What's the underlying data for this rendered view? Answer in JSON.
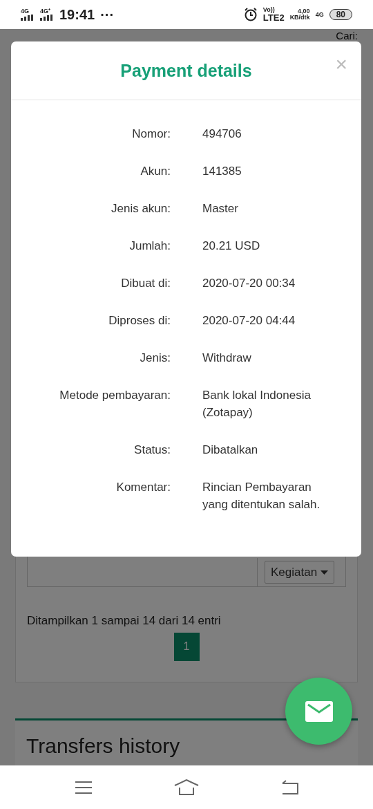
{
  "status_bar": {
    "network_1": "4G",
    "network_2": "4G⁺",
    "time": "19:41",
    "more": "···",
    "volte": "Vo))",
    "lte": "LTE2",
    "speed": "4,00",
    "speed_unit": "KB/dtk",
    "network_3": "4G",
    "battery": "80"
  },
  "background": {
    "search_label": "Cari:",
    "action_dropdown": "Kegiatan",
    "info": "Ditampilkan 1 sampai 14 dari 14 entri",
    "pages": [
      {
        "label": "1",
        "selected": true
      }
    ],
    "next_card_title": "Transfers history"
  },
  "modal": {
    "title": "Payment details",
    "close": "×",
    "fields": [
      {
        "label": "Nomor:",
        "value": "494706"
      },
      {
        "label": "Akun:",
        "value": "141385"
      },
      {
        "label": "Jenis akun:",
        "value": "Master"
      },
      {
        "label": "Jumlah:",
        "value": "20.21 USD"
      },
      {
        "label": "Dibuat di:",
        "value": "2020-07-20 00:34"
      },
      {
        "label": "Diproses di:",
        "value": "2020-07-20 04:44"
      },
      {
        "label": "Jenis:",
        "value": "Withdraw"
      },
      {
        "label": "Metode pembayaran:",
        "value": "Bank lokal Indonesia (Zotapay)"
      },
      {
        "label": "Status:",
        "value": "Dibatalkan"
      },
      {
        "label": "Komentar:",
        "value": "Rincian Pembayaran yang ditentukan salah."
      }
    ]
  }
}
